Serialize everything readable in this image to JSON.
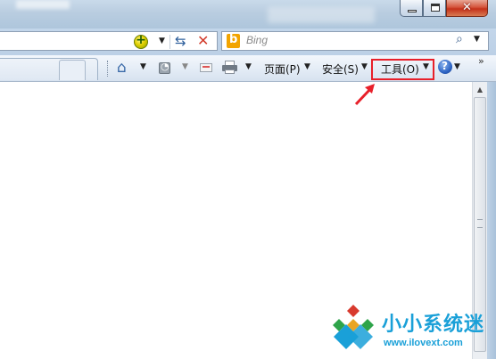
{
  "window": {
    "close_glyph": "✕"
  },
  "address_bar": {
    "compat_glyph": "+",
    "dropdown_glyph": "▼",
    "refresh_glyph": "⇆",
    "stop_glyph": "✕"
  },
  "search": {
    "engine_logo": "b",
    "placeholder": "Bing",
    "search_glyph": "⌕",
    "dropdown_glyph": "▼"
  },
  "command_bar": {
    "home_glyph": "⌂",
    "feeds_glyph": "◔",
    "items": [
      {
        "label": "页面(P)"
      },
      {
        "label": "安全(S)"
      },
      {
        "label": "工具(O)"
      }
    ],
    "help_glyph": "?",
    "more_glyph": "»",
    "arrow_glyph": "▼"
  },
  "highlight_color": "#e8202a",
  "scrollbar": {
    "up_glyph": "▲"
  },
  "watermark": {
    "text": "小小系统迷",
    "url": "www.ilovext.com",
    "color": "#1aa0d8"
  },
  "icons": [
    "minimize-icon",
    "maximize-icon",
    "close-icon",
    "compatibility-icon",
    "refresh-icon",
    "stop-icon",
    "bing-icon",
    "search-icon",
    "home-icon",
    "feeds-icon",
    "mail-icon",
    "print-icon",
    "help-icon",
    "chevron-icon",
    "arrow-annotation-icon",
    "watermark-logo-icon"
  ]
}
